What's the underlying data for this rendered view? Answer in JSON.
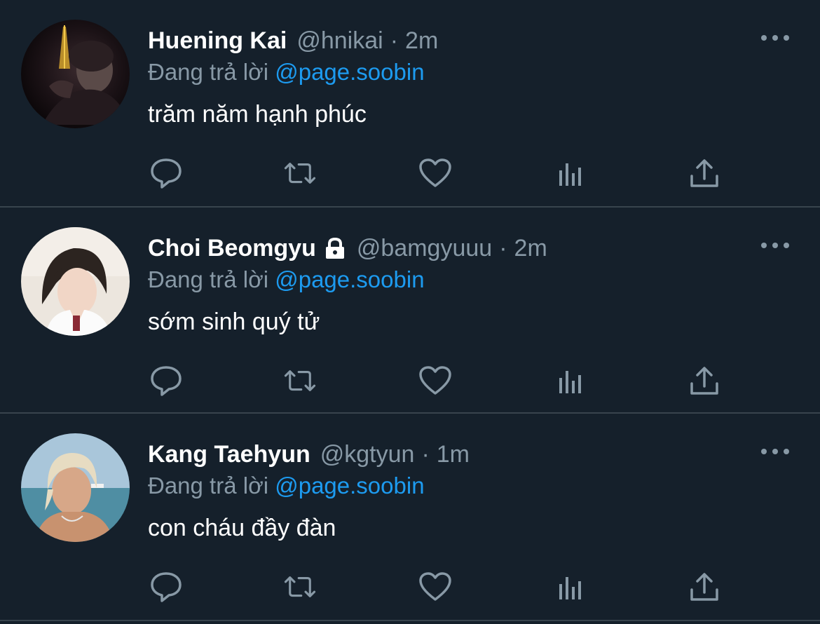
{
  "colors": {
    "background": "#15202b",
    "divider": "#38444d",
    "name": "#ffffff",
    "muted": "#8899a6",
    "mention": "#1d9bf0",
    "icon": "#8899a6"
  },
  "tweets": [
    {
      "name": "Huening Kai",
      "locked": false,
      "handle": "@hnikai",
      "separator": "·",
      "time": "2m",
      "reply_prefix": "Đang trả lời",
      "reply_mention": "@page.soobin",
      "text": "trăm năm hạnh phúc",
      "avatar": "photo-night-portrait"
    },
    {
      "name": "Choi Beomgyu",
      "locked": true,
      "handle": "@bamgyuuu",
      "separator": "·",
      "time": "2m",
      "reply_prefix": "Đang trả lời",
      "reply_mention": "@page.soobin",
      "text": "sớm sinh quý tử",
      "avatar": "photo-portrait-school-uniform"
    },
    {
      "name": "Kang Taehyun",
      "locked": false,
      "handle": "@kgtyun",
      "separator": "·",
      "time": "1m",
      "reply_prefix": "Đang trả lời",
      "reply_mention": "@page.soobin",
      "text": "con cháu đầy đàn",
      "avatar": "photo-beach-portrait"
    }
  ],
  "actions": [
    "reply-icon",
    "retweet-icon",
    "like-icon",
    "views-icon",
    "share-icon"
  ]
}
